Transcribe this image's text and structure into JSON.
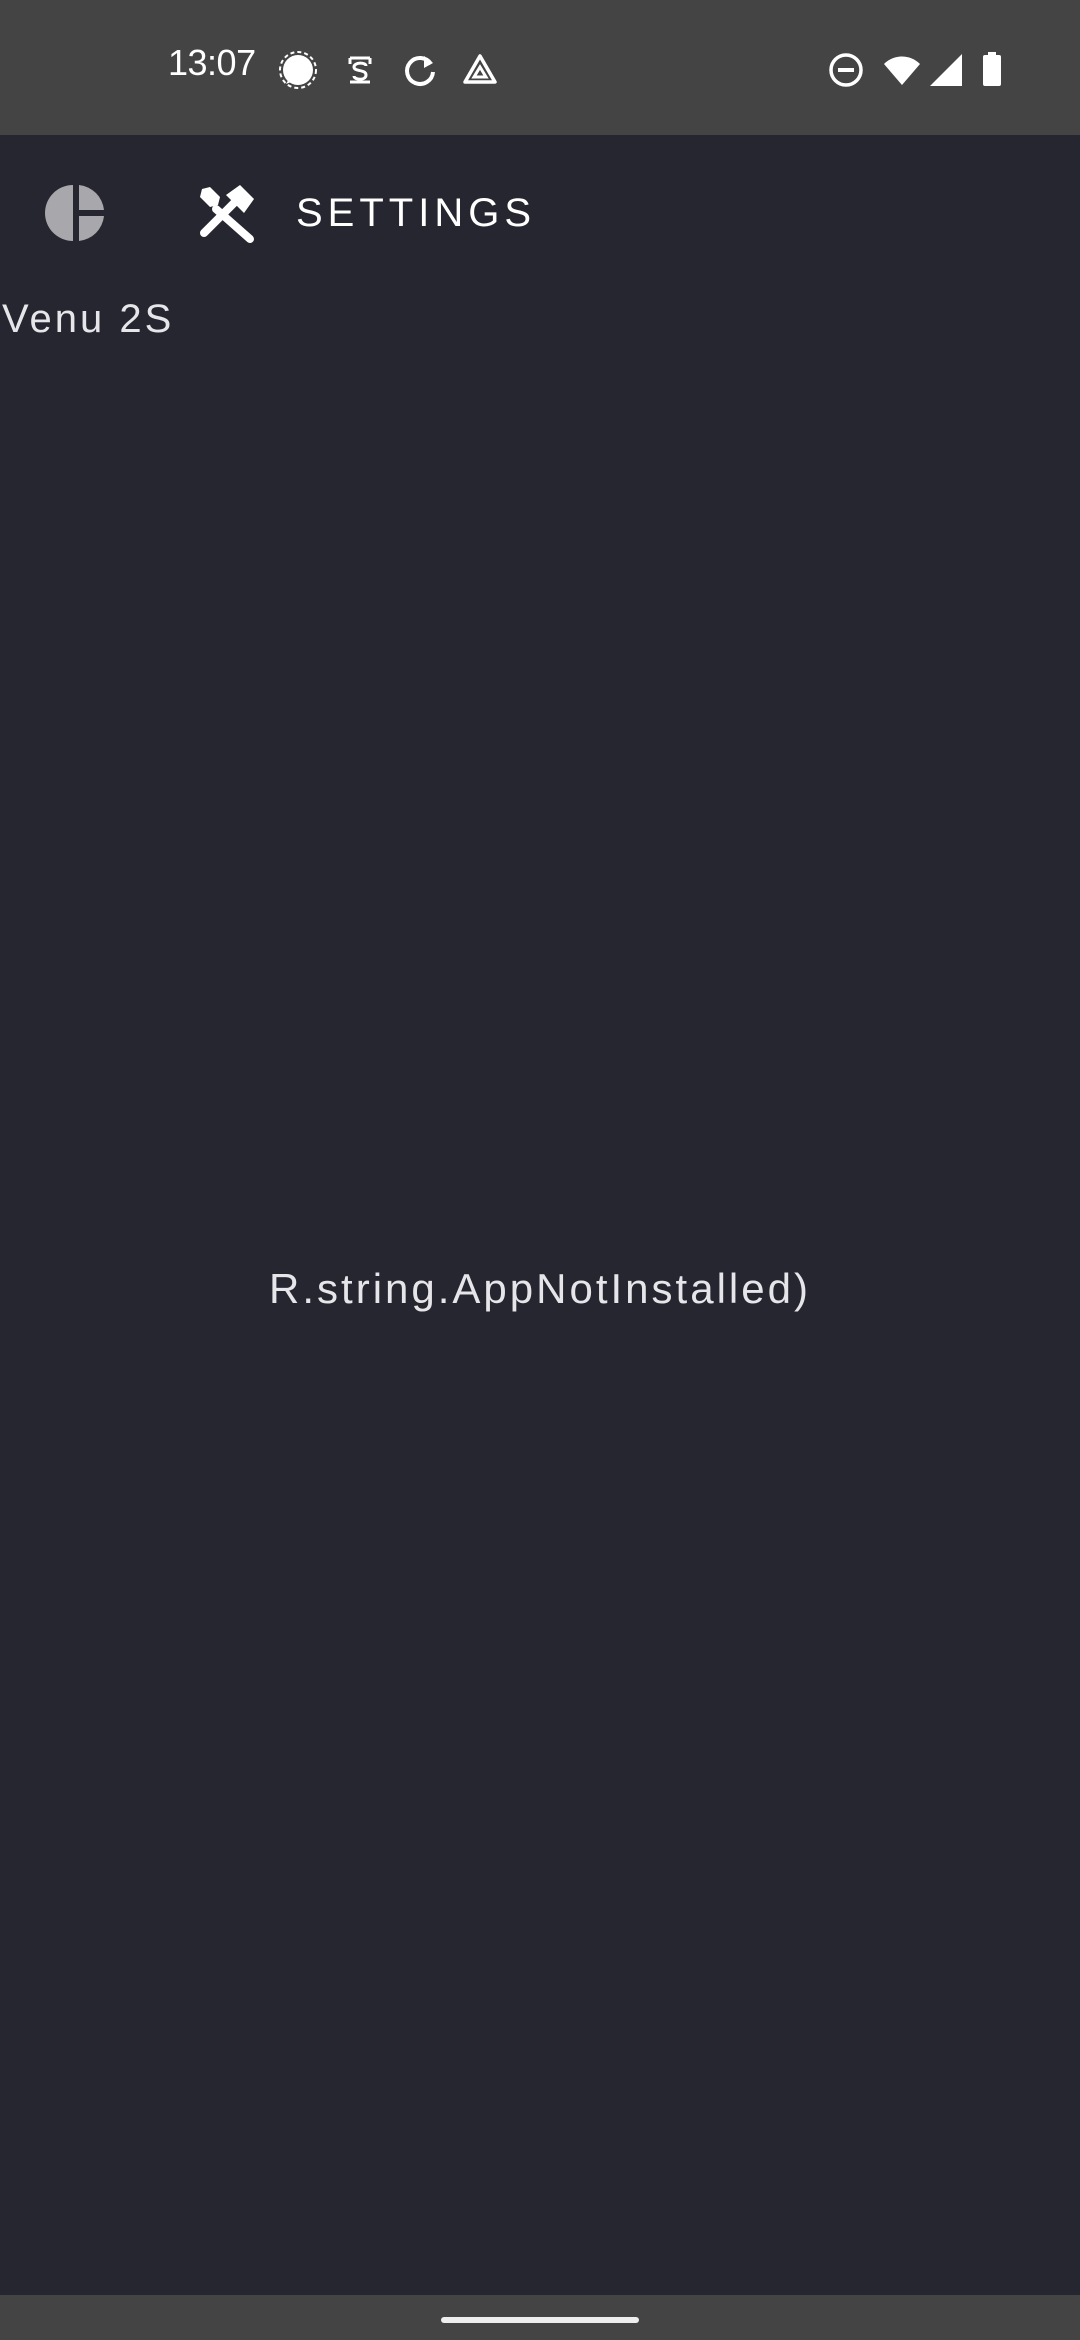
{
  "status_bar": {
    "time": "13:07",
    "notification_icons": [
      "signal-messenger-icon",
      "authenticator-icon",
      "sync-icon",
      "drive-icon"
    ],
    "system_icons": [
      "do-not-disturb-icon",
      "wifi-icon",
      "cell-signal-icon",
      "battery-icon"
    ]
  },
  "app_bar": {
    "tabs": [
      {
        "icon": "pie-chart-icon",
        "label": ""
      },
      {
        "icon": "tools-icon",
        "label": "SETTINGS"
      }
    ]
  },
  "device": {
    "name": "Venu 2S"
  },
  "main": {
    "message": "R.string.AppNotInstalled)"
  },
  "colors": {
    "background": "#262630",
    "system_bar": "#444444",
    "text": "#e6e6ea",
    "inactive_icon": "#a7a7ac"
  }
}
